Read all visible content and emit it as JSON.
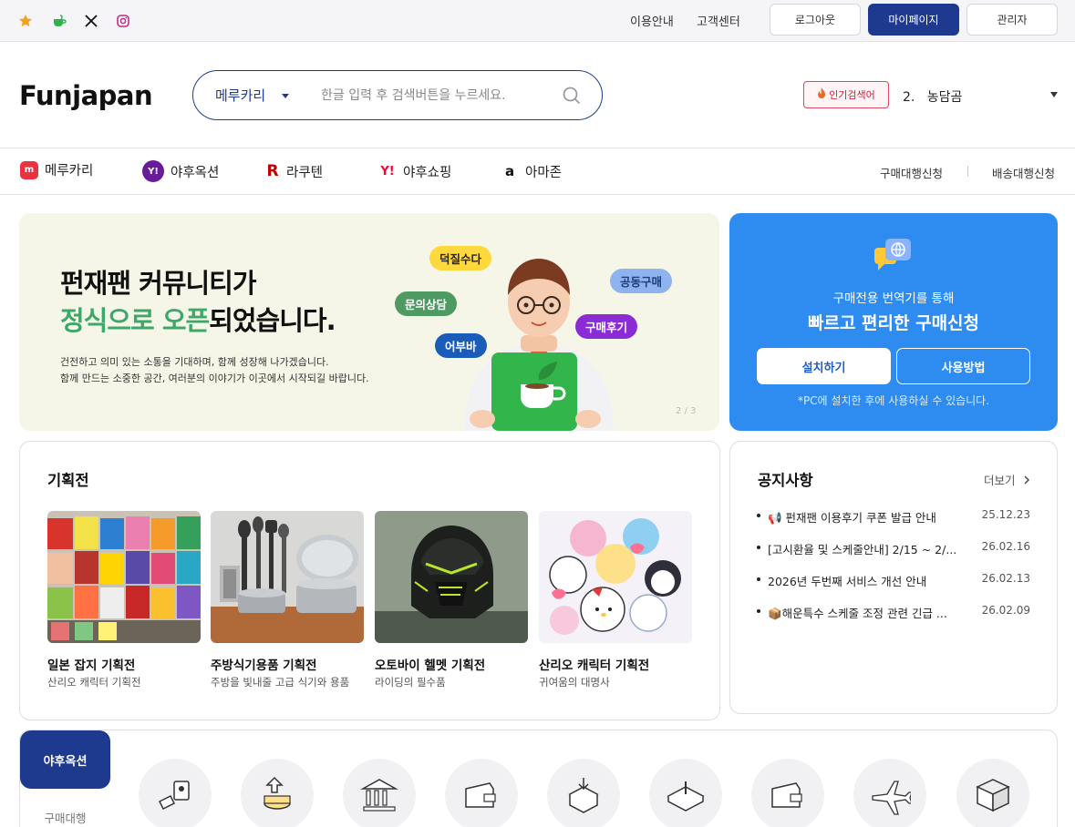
{
  "topbar": {
    "sns": [
      {
        "icon": "star-icon",
        "color": "#f4a21b"
      },
      {
        "icon": "cup-icon",
        "color": "#2fb24c"
      },
      {
        "icon": "x-icon",
        "color": "#111111"
      },
      {
        "icon": "instagram-icon",
        "color": "#c02d8c"
      }
    ],
    "links": [
      "이용안내",
      "고객센터"
    ],
    "logout_label": "로그아웃",
    "mypage_label": "마이페이지",
    "admin_label": "관리자"
  },
  "header": {
    "logo": "Funjapan",
    "search": {
      "selected": "메루카리",
      "placeholder": "한글 입력 후 검색버튼을 누르세요."
    },
    "popular_label": "인기검색어",
    "popular_rank": "2.",
    "popular_term": "농담곰"
  },
  "nav": {
    "items": [
      {
        "label": "메루카리",
        "icon": "mercari-icon"
      },
      {
        "label": "야후옥션",
        "icon": "yahoo-auction-icon"
      },
      {
        "label": "라쿠텐",
        "icon": "rakuten-icon"
      },
      {
        "label": "야후쇼핑",
        "icon": "yahoo-shopping-icon"
      },
      {
        "label": "아마존",
        "icon": "amazon-icon"
      }
    ],
    "right": [
      "구매대행신청",
      "배송대행신청"
    ]
  },
  "banner": {
    "title_line1": "펀재팬 커뮤니티가",
    "title_line2_highlight": "정식으로 오픈",
    "title_line2_rest": "되었습니다.",
    "desc_line1": "건전하고 의미 있는 소통을 기대하며, 함께 성장해 나가겠습니다.",
    "desc_line2": "함께 만드는 소중한 공간, 여러분의 이야기가 이곳에서 시작되길 바랍니다.",
    "bubbles": [
      "덕질수다",
      "문의상담",
      "어부바",
      "공동구매",
      "구매후기"
    ],
    "pager": "2 / 3"
  },
  "promo": {
    "line1": "구매전용 번역기를 통해",
    "line2": "빠르고 편리한 구매신청",
    "install_label": "설치하기",
    "howto_label": "사용방법",
    "note": "*PC에 설치한 후에 사용하실 수 있습니다."
  },
  "exhibitions": {
    "title": "기획전",
    "items": [
      {
        "title": "일본 잡지 기획전",
        "sub": "산리오 캐릭터 기획전"
      },
      {
        "title": "주방식기용품 기획전",
        "sub": "주방을 빛내줄 고급 식기와 용품"
      },
      {
        "title": "오토바이 헬멧 기획전",
        "sub": "라이딩의 필수품"
      },
      {
        "title": "산리오 캐릭터 기획전",
        "sub": "귀여움의 대명사"
      }
    ]
  },
  "notice": {
    "title": "공지사항",
    "more_label": "더보기",
    "items": [
      {
        "text": "📢 펀재팬 이용후기 쿠폰 발급 안내",
        "date": "25.12.23"
      },
      {
        "text": "[고시환율 및 스케줄안내] 2/15 ~ 2/...",
        "date": "26.02.16"
      },
      {
        "text": "2026년 두번째 서비스 개선 안내",
        "date": "26.02.13"
      },
      {
        "text": "📦해운특수 스케줄 조정 관련 긴급 ...",
        "date": "26.02.09"
      }
    ]
  },
  "service": {
    "tab_active": "야후옥션",
    "tab_next": "구매대행",
    "steps": [
      "bid-icon",
      "payment-icon",
      "bank-icon",
      "wallet-icon",
      "box-in-icon",
      "warehouse-icon",
      "wallet2-icon",
      "airplane-icon",
      "package-icon"
    ]
  }
}
